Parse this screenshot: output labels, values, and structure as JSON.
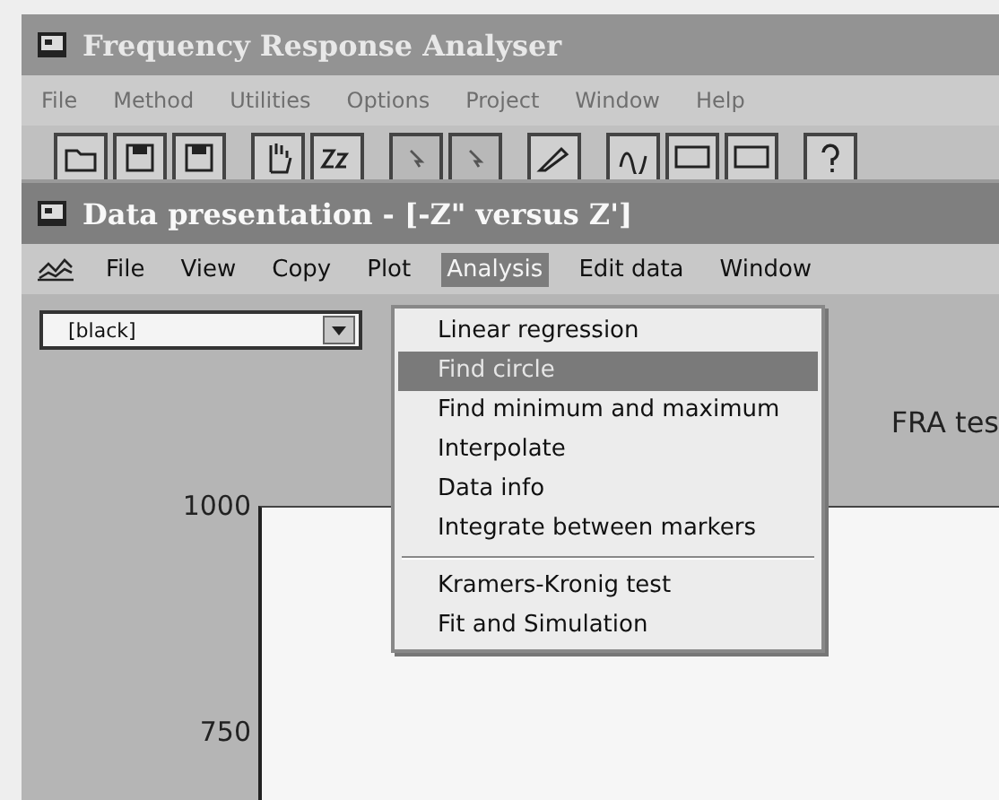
{
  "app_window": {
    "title": "Frequency Response Analyser",
    "menu": [
      "File",
      "Method",
      "Utilities",
      "Options",
      "Project",
      "Window",
      "Help"
    ],
    "toolbar": [
      {
        "kind": "open",
        "disabled": false
      },
      {
        "kind": "save",
        "disabled": false
      },
      {
        "kind": "save",
        "disabled": false
      },
      {
        "kind": "gap"
      },
      {
        "kind": "hand",
        "disabled": false
      },
      {
        "kind": "zz",
        "disabled": false
      },
      {
        "kind": "gap"
      },
      {
        "kind": "pointer",
        "disabled": true
      },
      {
        "kind": "pointer",
        "disabled": true
      },
      {
        "kind": "gap"
      },
      {
        "kind": "pen",
        "disabled": false
      },
      {
        "kind": "gap"
      },
      {
        "kind": "graph",
        "disabled": false
      },
      {
        "kind": "screen",
        "disabled": false
      },
      {
        "kind": "screen",
        "disabled": false
      },
      {
        "kind": "gap"
      },
      {
        "kind": "help",
        "disabled": false
      }
    ]
  },
  "data_window": {
    "title": "Data presentation - [-Z\" versus Z']",
    "menu": [
      {
        "label": "File",
        "selected": false
      },
      {
        "label": "View",
        "selected": false
      },
      {
        "label": "Copy",
        "selected": false
      },
      {
        "label": "Plot",
        "selected": false
      },
      {
        "label": "Analysis",
        "selected": true
      },
      {
        "label": "Edit data",
        "selected": false
      },
      {
        "label": "Window",
        "selected": false
      }
    ],
    "color_select": {
      "value": "[black]"
    },
    "plot": {
      "title": "FRA tes",
      "y_labels": [
        "1000",
        "750"
      ]
    },
    "analysis_menu": [
      [
        {
          "label": "Linear regression",
          "selected": false,
          "disabled": false
        },
        {
          "label": "Find circle",
          "selected": true,
          "disabled": true
        },
        {
          "label": "Find minimum and maximum",
          "selected": false,
          "disabled": false
        },
        {
          "label": "Interpolate",
          "selected": false,
          "disabled": false
        },
        {
          "label": "Data info",
          "selected": false,
          "disabled": false
        },
        {
          "label": "Integrate between markers",
          "selected": false,
          "disabled": false
        }
      ],
      [
        {
          "label": "Kramers-Kronig test",
          "selected": false,
          "disabled": false
        },
        {
          "label": "Fit and Simulation",
          "selected": false,
          "disabled": false
        }
      ]
    ]
  }
}
